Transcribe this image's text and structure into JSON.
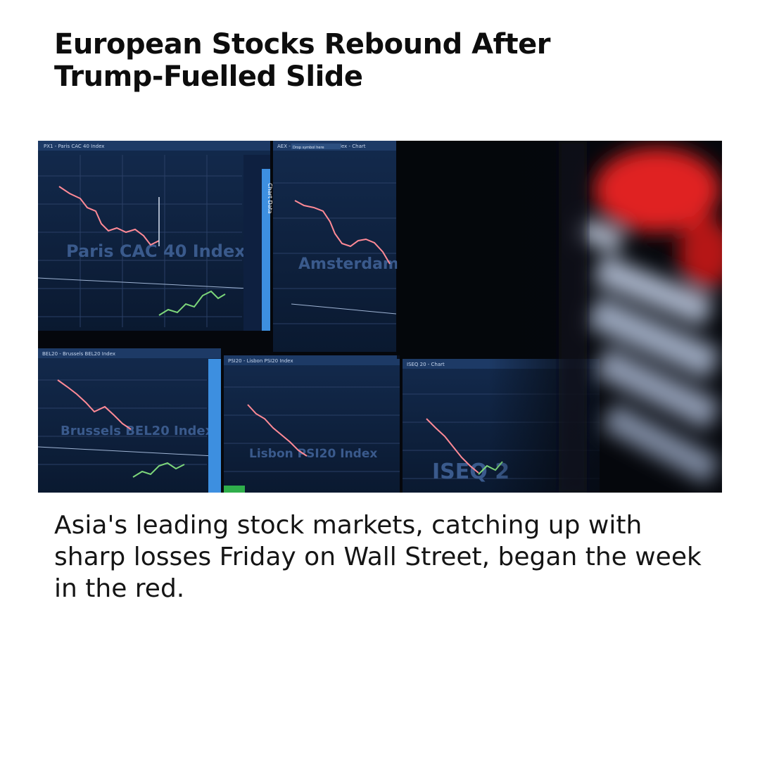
{
  "article": {
    "headline_line1": "European Stocks Rebound After",
    "headline_line2": "Trump-Fuelled Slide",
    "body": "Asia's leading stock markets, catching up with sharp losses Friday on Wall Street, began the week in the red."
  },
  "photo": {
    "panel_cac": "Paris CAC 40 Index",
    "panel_amsterdam": "Amsterdam",
    "panel_brussels": "Brussels BEL20 Index",
    "panel_lisbon": "Lisbon PSI20 Index",
    "panel_iseq": "ISEQ 2",
    "header_cac": "PX1 - Paris CAC 40 Index",
    "header_amsterdam": "AEX - Amsterdam AEX Index - Chart",
    "header_brussels": "BEL20 - Brussels BEL20 Index",
    "header_lisbon": "PSI20 - Lisbon PSI20 Index",
    "header_iseq": "ISEQ 20 - Chart",
    "tab_chart_data": "Chart Data",
    "btn_drop_symbol": "Drop symbol here",
    "colors": {
      "screen_bg": "#0b1a33",
      "grid": "#2a3f66",
      "up": "#7dd67a",
      "down": "#ff8a96",
      "accent": "#3d8fe0",
      "blur_red": "#e02020"
    }
  }
}
